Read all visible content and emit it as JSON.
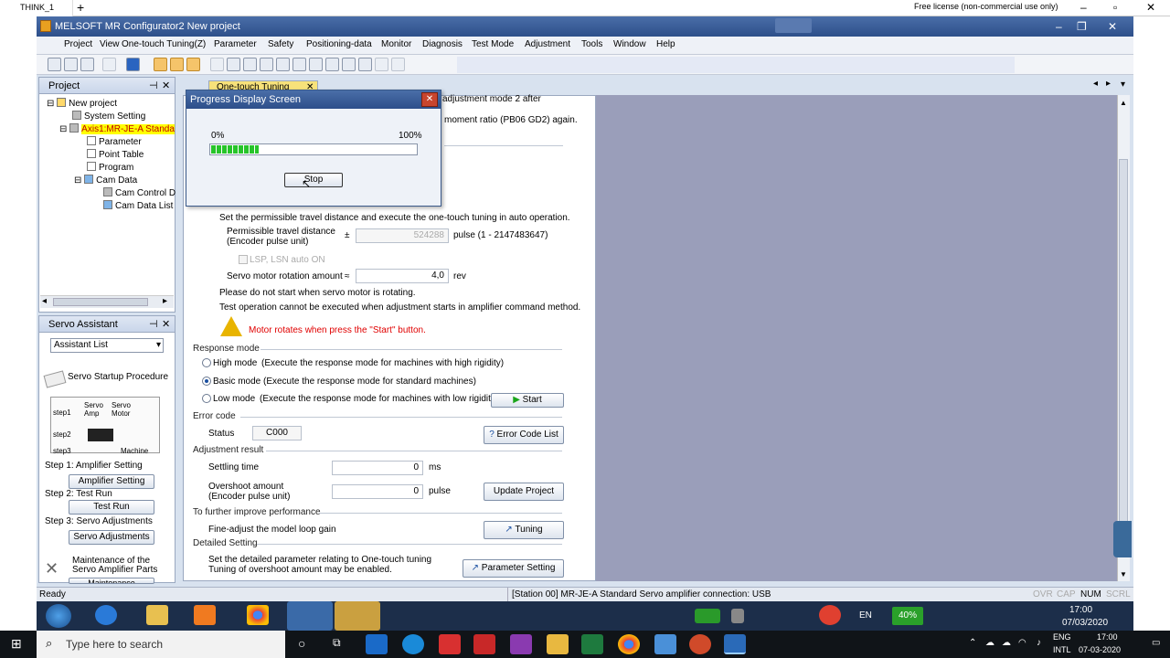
{
  "remote": {
    "tab_title": "THINK_1",
    "new_tab": "+",
    "license": "Free license (non-commercial use only)"
  },
  "window": {
    "title": "MELSOFT MR Configurator2 New project"
  },
  "menu": [
    "Project",
    "View",
    "One-touch Tuning(Z)",
    "Parameter",
    "Safety",
    "Positioning-data",
    "Monitor",
    "Diagnosis",
    "Test Mode",
    "Adjustment",
    "Tools",
    "Window",
    "Help"
  ],
  "project_panel": {
    "title": "Project",
    "tree": {
      "root": "New project",
      "system": "System Setting",
      "axis": "Axis1:MR-JE-A Standa",
      "parameter": "Parameter",
      "point_table": "Point Table",
      "program": "Program",
      "cam_data": "Cam Data",
      "cam_control": "Cam Control D",
      "cam_list": "Cam Data List"
    }
  },
  "servo_panel": {
    "title": "Servo Assistant",
    "dropdown": "Assistant List",
    "startup": "Servo Startup Procedure",
    "diagram": {
      "step1": "step1",
      "step2": "step2",
      "step3": "step3",
      "amp": "Servo Amp",
      "motor": "Servo Motor",
      "machine": "Machine"
    },
    "step1_label": "Step 1: Amplifier Setting",
    "step1_btn": "Amplifier Setting",
    "step2_label": "Step 2: Test Run",
    "step2_btn": "Test Run",
    "step3_label": "Step 3: Servo Adjustments",
    "step3_btn": "Servo Adjustments",
    "maint": "Maintenance of the Servo Amplifier Parts",
    "maint_btn": "Maintenance"
  },
  "doc_tab": "One-touch Tuning",
  "content": {
    "top1": "adjustment mode 2 after",
    "top2": "moment ratio (PB06 GD2) again.",
    "set_travel": "Set the permissible travel distance and execute the one-touch tuning in auto operation.",
    "travel_label": "Permissible travel distance (Encoder pulse unit)",
    "pm": "±",
    "travel_value": "524288",
    "travel_unit": "pulse (1 - 2147483647)",
    "lsp": "LSP, LSN auto ON",
    "rotation_label": "Servo motor rotation amount",
    "approx": "≈",
    "rotation_value": "4,0",
    "rotation_unit": "rev",
    "note1": "Please do not start when servo motor is rotating.",
    "note2": "Test operation cannot be executed when adjustment starts in amplifier command method.",
    "warning": "Motor rotates when press the \"Start\" button.",
    "response_mode": "Response mode",
    "high": "High mode",
    "high_desc": "(Execute the response mode for machines with high rigidity)",
    "basic": "Basic mode",
    "basic_desc": "(Execute the response mode for standard machines)",
    "low": "Low mode",
    "low_desc": "(Execute the response mode for machines with low rigidity)",
    "start_btn": "Start",
    "error_code": "Error code",
    "status_label": "Status",
    "status_value": "C000",
    "error_list_btn": "Error Code List",
    "adj_result": "Adjustment result",
    "settling_label": "Settling time",
    "settling_value": "0",
    "settling_unit": "ms",
    "overshoot_label": "Overshoot amount (Encoder pulse unit)",
    "overshoot_value": "0",
    "overshoot_unit": "pulse",
    "update_btn": "Update Project",
    "improve": "To further improve performance",
    "fine": "Fine-adjust the model loop gain",
    "tuning_btn": "Tuning",
    "detailed": "Detailed Setting",
    "detail_desc1": "Set the detailed parameter relating to One-touch tuning",
    "detail_desc2": "Tuning of overshoot amount may be enabled.",
    "param_btn": "Parameter Setting"
  },
  "dialog": {
    "title": "Progress Display Screen",
    "close": "✕",
    "min": "0%",
    "max": "100%",
    "progress": 0.23,
    "stop_btn": "Stop"
  },
  "status": {
    "left": "Ready",
    "station": "[Station 00] MR-JE-A Standard Servo amplifier connection: USB",
    "ovr": "OVR",
    "cap": "CAP",
    "num": "NUM",
    "scrl": "SCRL"
  },
  "win7_taskbar": {
    "lang": "EN",
    "battery": "40%",
    "time": "17:00",
    "date": "07/03/2020"
  },
  "win10_taskbar": {
    "search": "Type here to search",
    "lang1": "ENG",
    "lang2": "INTL",
    "time": "17:00",
    "date": "07-03-2020"
  },
  "colors": {
    "accent": "#2d4f8a",
    "progress": "#27c42a",
    "warning": "#e00000",
    "selected": "#ffff00"
  }
}
